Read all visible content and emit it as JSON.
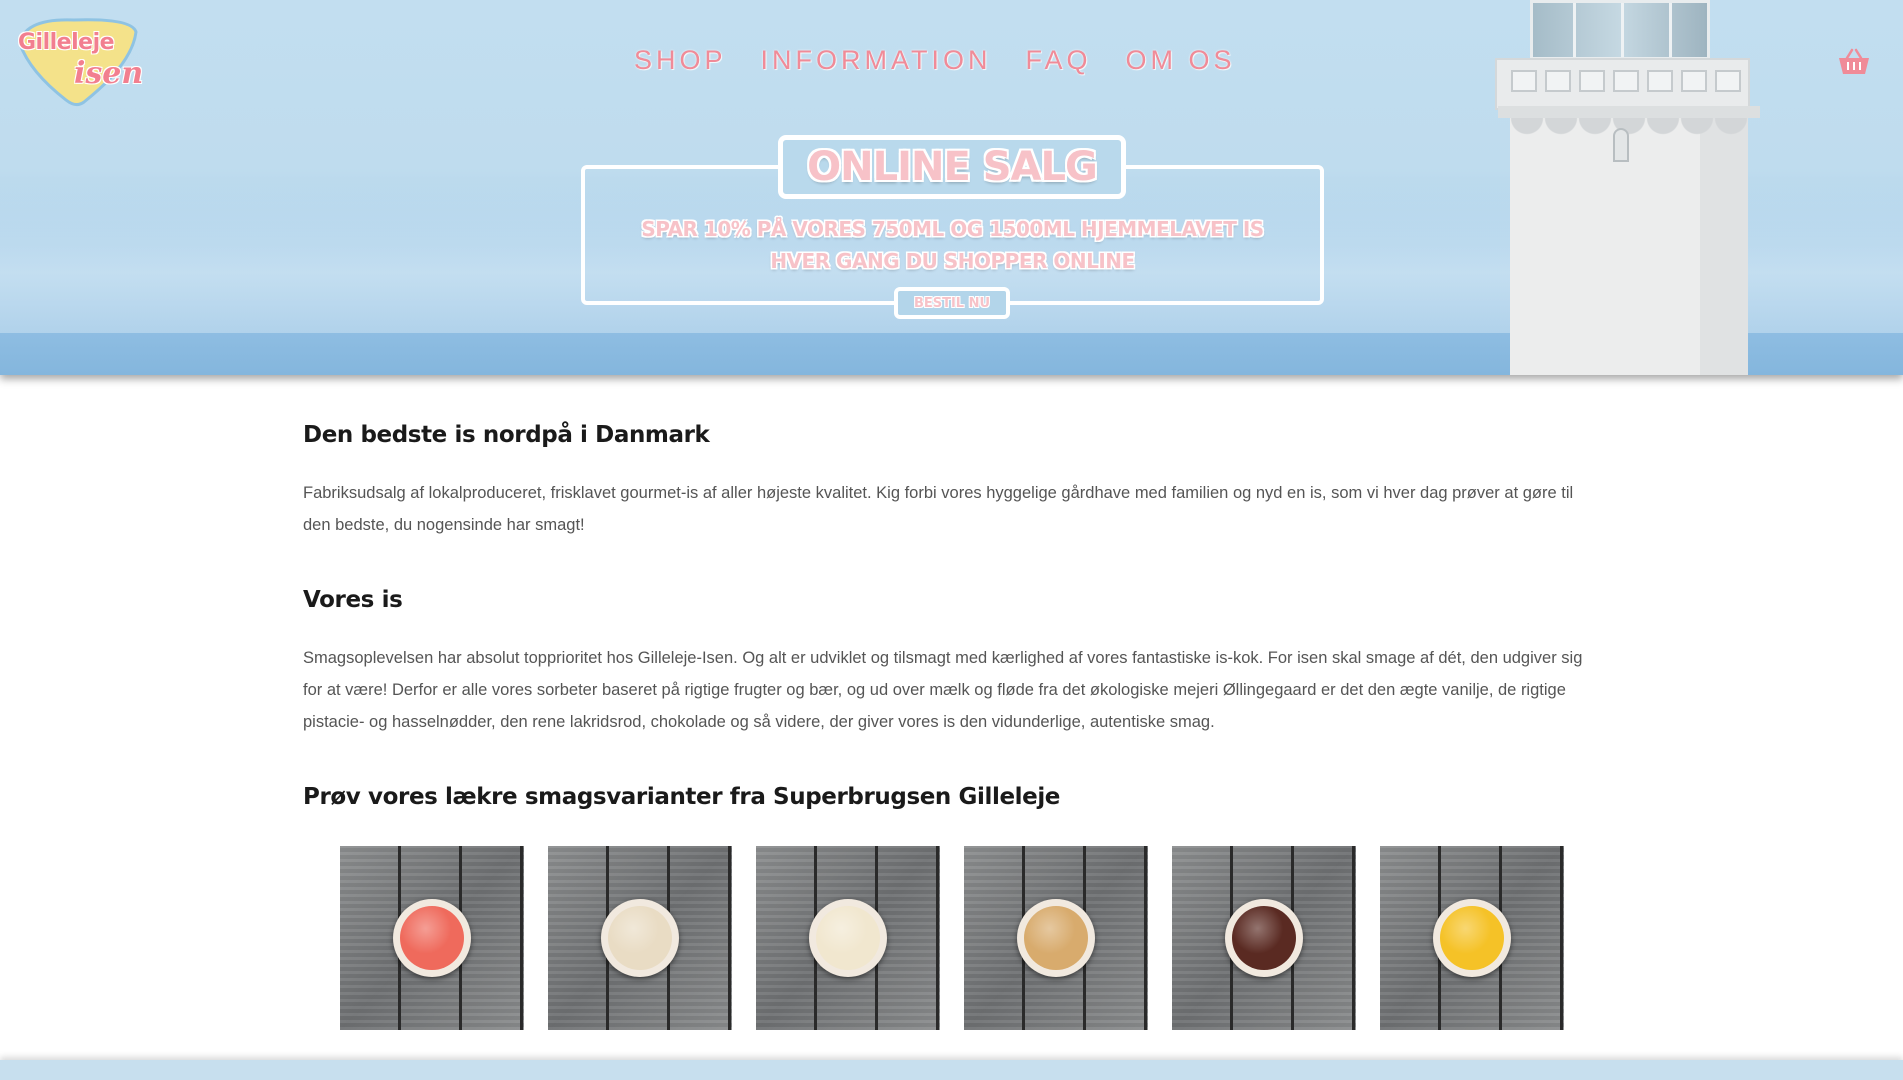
{
  "header": {
    "logo": {
      "line1": "Gilleleje",
      "line2": "isen"
    },
    "nav": [
      {
        "label": "SHOP"
      },
      {
        "label": "INFORMATION"
      },
      {
        "label": "FAQ"
      },
      {
        "label": "OM OS"
      }
    ],
    "cart_icon": "basket-icon"
  },
  "banner": {
    "title": "ONLINE SALG",
    "subtitle_line1": "SPAR 10% PÅ VORES 750ML OG 1500ML HJEMMELAVET IS",
    "subtitle_line2": "HVER GANG DU SHOPPER ONLINE",
    "button_label": "BESTIL NU"
  },
  "sections": [
    {
      "heading": "Den bedste is nordpå i Danmark",
      "text": "Fabriksudsalg af lokalproduceret, frisklavet gourmet-is af aller højeste kvalitet. Kig forbi vores hyggelige gårdhave med familien og nyd en is, som vi hver dag prøver at gøre til den bedste, du nogensinde har smagt!"
    },
    {
      "heading": "Vores is",
      "text": "Smagsoplevelsen har absolut topprioritet hos Gilleleje-Isen. Og alt er udviklet og tilsmagt med kærlighed af vores fantastiske is-kok. For isen skal smage af dét, den udgiver sig for at være! Derfor er alle vores sorbeter baseret på rigtige frugter og bær, og ud over mælk og fløde fra det økologiske mejeri Øllingegaard er det den ægte vanilje, de rigtige pistacie- og hasselnødder, den rene lakridsrod, chokolade og så videre, der giver vores is den vidunderlige, autentiske smag."
    },
    {
      "heading": "Prøv vores lækre smagsvarianter fra Superbrugsen Gilleleje"
    }
  ],
  "flavors": [
    {
      "color": "#ef6a5c"
    },
    {
      "color": "#e9dcc4"
    },
    {
      "color": "#f1e7cf"
    },
    {
      "color": "#d8ab6d"
    },
    {
      "color": "#5a2a22"
    },
    {
      "color": "#f5c227"
    }
  ],
  "colors": {
    "accent_pink": "#f08b98",
    "sky_blue": "#c2def0",
    "heading": "#1a1a1a",
    "body_text": "#555555"
  }
}
